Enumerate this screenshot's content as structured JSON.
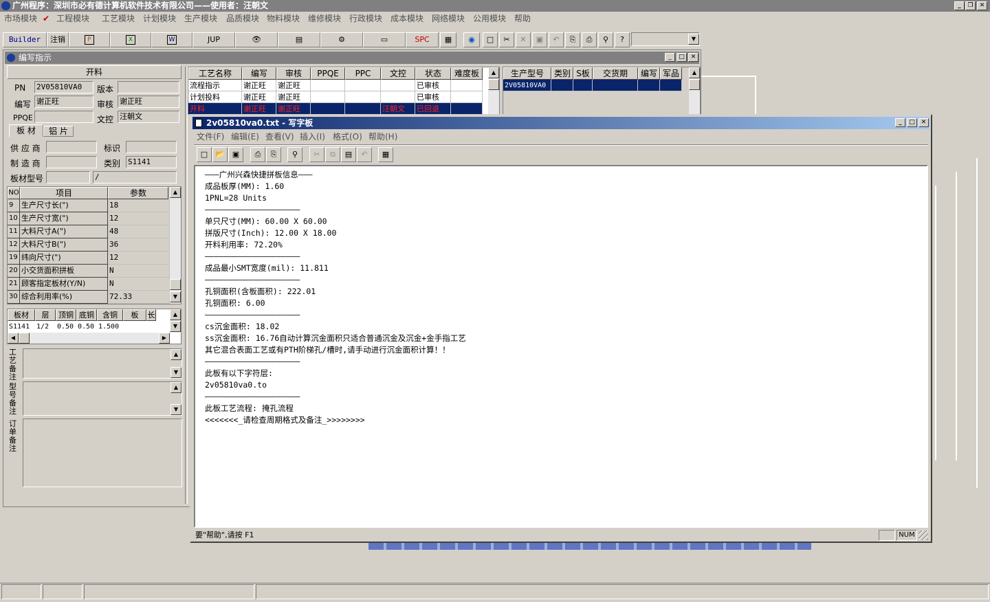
{
  "app": {
    "title": "广州程序：深圳市必有德计算机软件技术有限公司——使用者：汪朝文",
    "menu": [
      "市场模块",
      "工程模块",
      "工艺模块",
      "计划模块",
      "生产模块",
      "品质模块",
      "物料模块",
      "维修模块",
      "行政模块",
      "成本模块",
      "网络模块",
      "公用模块",
      "帮助"
    ],
    "toolbar": {
      "builder": "Builder",
      "logout": "注销",
      "jup": "JUP",
      "spc": "SPC"
    }
  },
  "editor_window": {
    "title": "编写指示",
    "section": "开料",
    "pn_label": "PN",
    "pn_value": "2V05810VA0",
    "version_label": "版本",
    "version_value": "",
    "writer_label": "编写",
    "writer_value": "谢正旺",
    "review_label": "审核",
    "review_value": "谢正旺",
    "ppqe_label": "PPQE",
    "ppqe_value": "",
    "doc_label": "文控",
    "doc_value": "汪朝文",
    "tabs": [
      "板 材",
      "铝 片"
    ],
    "supplier_label": "供 应 商",
    "supplier_value": "",
    "mark_label": "标识",
    "mark_value": "",
    "maker_label": "制 造 商",
    "maker_value": "",
    "class_label": "类别",
    "class_value": "S1141",
    "model_label": "板材型号",
    "model_value": "",
    "model_value2": "/",
    "param_headers": [
      "NO",
      "项目",
      "参数"
    ],
    "params": [
      [
        "9",
        "生产尺寸长(\")",
        "18"
      ],
      [
        "10",
        "生产尺寸宽(\")",
        "12"
      ],
      [
        "11",
        "大料尺寸A(\")",
        "48"
      ],
      [
        "12",
        "大料尺寸B(\")",
        "36"
      ],
      [
        "19",
        "纬向尺寸(\")",
        "12"
      ],
      [
        "20",
        "小交货面积拼板",
        "N"
      ],
      [
        "21",
        "顾客指定板材(Y/N)",
        "N"
      ],
      [
        "30",
        "综合利用率(%)",
        "72.33"
      ]
    ],
    "mat_headers": [
      "板材",
      "层",
      "顶铜",
      "底铜",
      "含铜mm",
      "板mm",
      "长"
    ],
    "mat_rows": [
      [
        "S1141",
        "1/2",
        "0.50",
        "0.50",
        "1.500",
        "",
        ""
      ]
    ],
    "note_labels": [
      "工艺备注",
      "型号备注",
      "订单备注"
    ]
  },
  "process_grid": {
    "headers": [
      "工艺名称",
      "编写",
      "审核",
      "PPQE",
      "PPC",
      "文控",
      "状态",
      "难度板"
    ],
    "rows": [
      [
        "流程指示",
        "谢正旺",
        "谢正旺",
        "",
        "",
        "",
        "已审核",
        ""
      ],
      [
        "计划投料",
        "谢正旺",
        "谢正旺",
        "",
        "",
        "",
        "已审核",
        ""
      ],
      [
        "开料",
        "谢正旺",
        "谢正旺",
        "",
        "",
        "汪朝文",
        "已回退",
        ""
      ]
    ]
  },
  "order_grid": {
    "headers": [
      "生产型号",
      "类别",
      "S板",
      "交货期",
      "编写",
      "军品"
    ],
    "rows": [
      [
        "2V05810VA0",
        "",
        "",
        "",
        "",
        ""
      ]
    ]
  },
  "wordpad": {
    "title": "2v05810va0.txt - 写字板",
    "menu": [
      "文件(F)",
      "编辑(E)",
      "查看(V)",
      "插入(I)",
      "格式(O)",
      "帮助(H)"
    ],
    "lines": [
      "———广州兴森快捷拼板信息———",
      "成品板厚(MM): 1.60",
      "1PNL=28 Units",
      "————————————————————",
      "单只尺寸(MM): 60.00 X 60.00",
      "拼版尺寸(Inch): 12.00 X 18.00",
      "开料利用率: 72.20%",
      "————————————————————",
      "成品最小SMT宽度(mil): 11.811",
      "————————————————————",
      "孔铜面积(含板面积): 222.01",
      "孔铜面积: 6.00",
      "————————————————————",
      "cs沉金面积: 18.02",
      "ss沉金面积: 16.76自动计算沉金面积只适合普通沉金及沉金+金手指工艺",
      "其它混合表面工艺或有PTH阶梯孔/槽时,请手动进行沉金面积计算！！",
      "————————————————————",
      "此板有以下字符层:",
      "2v05810va0.to",
      "————————————————————",
      "此板工艺流程: 掩孔流程",
      "<<<<<<<_请检查周期格式及备注_>>>>>>>>"
    ],
    "status": "要\"帮助\",请按 F1",
    "num": "NUM"
  }
}
